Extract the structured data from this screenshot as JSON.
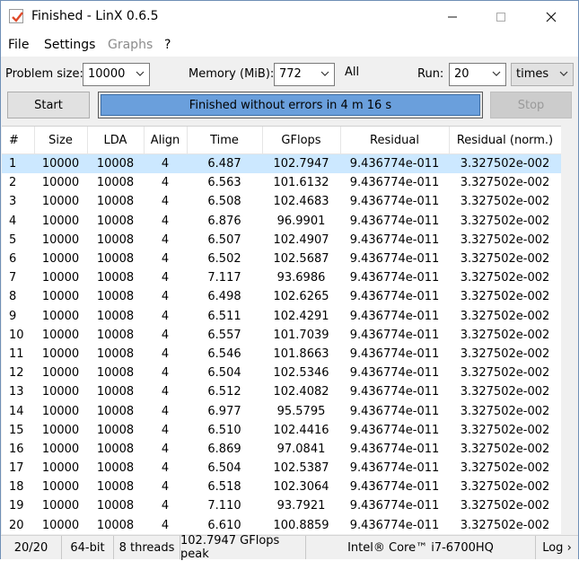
{
  "window": {
    "title": "Finished - LinX 0.6.5",
    "minimize_icon": "minimize-icon",
    "maximize_icon": "maximize-icon",
    "close_icon": "close-icon",
    "app_icon": "checkmark-app-icon"
  },
  "menu": {
    "items": [
      {
        "label": "File",
        "enabled": true
      },
      {
        "label": "Settings",
        "enabled": true
      },
      {
        "label": "Graphs",
        "enabled": false
      },
      {
        "label": "?",
        "enabled": true
      }
    ]
  },
  "controls": {
    "problem_size_label": "Problem size:",
    "problem_size_value": "10000",
    "memory_label": "Memory (MiB):",
    "memory_value": "772",
    "memory_all": "All",
    "run_label": "Run:",
    "run_value": "20",
    "run_unit": "times"
  },
  "actions": {
    "start_label": "Start",
    "stop_label": "Stop",
    "status_message": "Finished without errors in 4 m 16 s",
    "progress_fraction": 1.0,
    "progress_color": "#6a9fdc"
  },
  "table": {
    "columns": [
      "#",
      "Size",
      "LDA",
      "Align",
      "Time",
      "GFlops",
      "Residual",
      "Residual (norm.)"
    ],
    "selected_row": 0,
    "rows": [
      [
        "1",
        "10000",
        "10008",
        "4",
        "6.487",
        "102.7947",
        "9.436774e-011",
        "3.327502e-002"
      ],
      [
        "2",
        "10000",
        "10008",
        "4",
        "6.563",
        "101.6132",
        "9.436774e-011",
        "3.327502e-002"
      ],
      [
        "3",
        "10000",
        "10008",
        "4",
        "6.508",
        "102.4683",
        "9.436774e-011",
        "3.327502e-002"
      ],
      [
        "4",
        "10000",
        "10008",
        "4",
        "6.876",
        "96.9901",
        "9.436774e-011",
        "3.327502e-002"
      ],
      [
        "5",
        "10000",
        "10008",
        "4",
        "6.507",
        "102.4907",
        "9.436774e-011",
        "3.327502e-002"
      ],
      [
        "6",
        "10000",
        "10008",
        "4",
        "6.502",
        "102.5687",
        "9.436774e-011",
        "3.327502e-002"
      ],
      [
        "7",
        "10000",
        "10008",
        "4",
        "7.117",
        "93.6986",
        "9.436774e-011",
        "3.327502e-002"
      ],
      [
        "8",
        "10000",
        "10008",
        "4",
        "6.498",
        "102.6265",
        "9.436774e-011",
        "3.327502e-002"
      ],
      [
        "9",
        "10000",
        "10008",
        "4",
        "6.511",
        "102.4291",
        "9.436774e-011",
        "3.327502e-002"
      ],
      [
        "10",
        "10000",
        "10008",
        "4",
        "6.557",
        "101.7039",
        "9.436774e-011",
        "3.327502e-002"
      ],
      [
        "11",
        "10000",
        "10008",
        "4",
        "6.546",
        "101.8663",
        "9.436774e-011",
        "3.327502e-002"
      ],
      [
        "12",
        "10000",
        "10008",
        "4",
        "6.504",
        "102.5346",
        "9.436774e-011",
        "3.327502e-002"
      ],
      [
        "13",
        "10000",
        "10008",
        "4",
        "6.512",
        "102.4082",
        "9.436774e-011",
        "3.327502e-002"
      ],
      [
        "14",
        "10000",
        "10008",
        "4",
        "6.977",
        "95.5795",
        "9.436774e-011",
        "3.327502e-002"
      ],
      [
        "15",
        "10000",
        "10008",
        "4",
        "6.510",
        "102.4416",
        "9.436774e-011",
        "3.327502e-002"
      ],
      [
        "16",
        "10000",
        "10008",
        "4",
        "6.869",
        "97.0841",
        "9.436774e-011",
        "3.327502e-002"
      ],
      [
        "17",
        "10000",
        "10008",
        "4",
        "6.504",
        "102.5387",
        "9.436774e-011",
        "3.327502e-002"
      ],
      [
        "18",
        "10000",
        "10008",
        "4",
        "6.518",
        "102.3064",
        "9.436774e-011",
        "3.327502e-002"
      ],
      [
        "19",
        "10000",
        "10008",
        "4",
        "7.110",
        "93.7921",
        "9.436774e-011",
        "3.327502e-002"
      ],
      [
        "20",
        "10000",
        "10008",
        "4",
        "6.610",
        "100.8859",
        "9.436774e-011",
        "3.327502e-002"
      ]
    ]
  },
  "status_bar": {
    "runs": "20/20",
    "arch": "64-bit",
    "threads": "8 threads",
    "peak": "102.7947 GFlops peak",
    "cpu": "Intel® Core™ i7-6700HQ",
    "log": "Log ›"
  }
}
